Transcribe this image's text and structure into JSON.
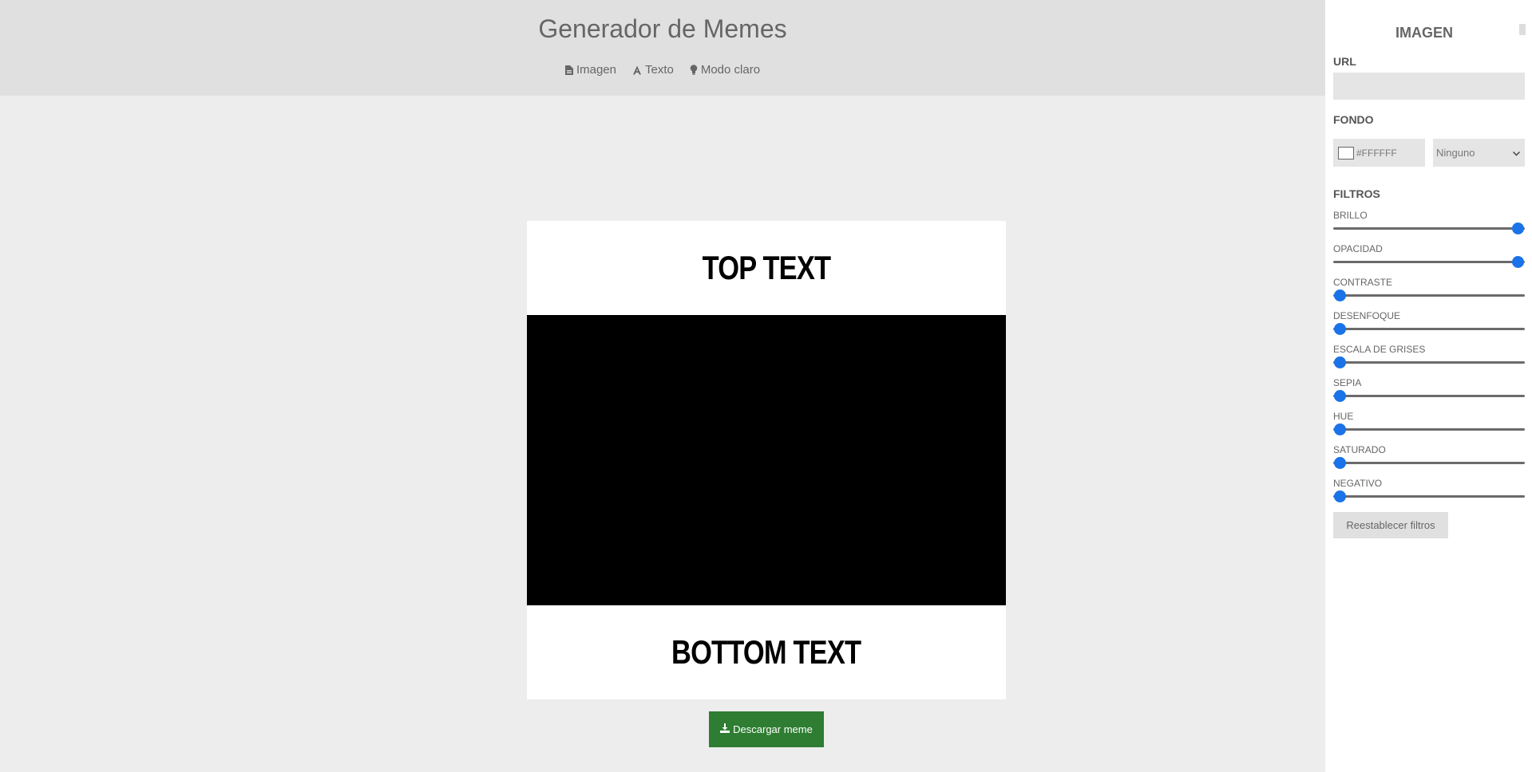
{
  "header": {
    "title": "Generador de Memes",
    "nav": [
      {
        "label": "Imagen",
        "icon": "file-image-icon"
      },
      {
        "label": "Texto",
        "icon": "font-icon"
      },
      {
        "label": "Modo claro",
        "icon": "lightbulb-icon"
      }
    ]
  },
  "meme": {
    "top_text": "TOP TEXT",
    "bottom_text": "BOTTOM TEXT",
    "download_label": "Descargar meme"
  },
  "panel": {
    "title": "IMAGEN",
    "url_label": "URL",
    "url_value": "",
    "fondo_label": "FONDO",
    "bg_color": "#FFFFFF",
    "blend_mode": "Ninguno",
    "filtros_label": "FILTROS",
    "filters": [
      {
        "label": "BRILLO",
        "value": 1
      },
      {
        "label": "OPACIDAD",
        "value": 1
      },
      {
        "label": "CONTRASTE",
        "value": 0
      },
      {
        "label": "DESENFOQUE",
        "value": 0
      },
      {
        "label": "ESCALA DE GRISES",
        "value": 0
      },
      {
        "label": "SEPIA",
        "value": 0
      },
      {
        "label": "HUE",
        "value": 0
      },
      {
        "label": "SATURADO",
        "value": 0
      },
      {
        "label": "NEGATIVO",
        "value": 0
      }
    ],
    "reset_label": "Reestablecer filtros"
  },
  "colors": {
    "accent": "#1a73e8",
    "download_bg": "#2e7d32",
    "header_bg": "#e0e0e0",
    "page_bg": "#ededed"
  }
}
